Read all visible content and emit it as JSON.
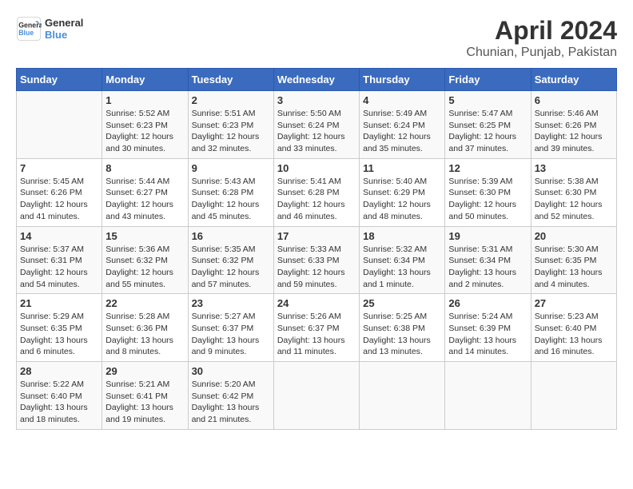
{
  "logo": {
    "line1": "General",
    "line2": "Blue"
  },
  "title": "April 2024",
  "subtitle": "Chunian, Punjab, Pakistan",
  "days_of_week": [
    "Sunday",
    "Monday",
    "Tuesday",
    "Wednesday",
    "Thursday",
    "Friday",
    "Saturday"
  ],
  "weeks": [
    [
      {
        "day": "",
        "info": ""
      },
      {
        "day": "1",
        "info": "Sunrise: 5:52 AM\nSunset: 6:23 PM\nDaylight: 12 hours\nand 30 minutes."
      },
      {
        "day": "2",
        "info": "Sunrise: 5:51 AM\nSunset: 6:23 PM\nDaylight: 12 hours\nand 32 minutes."
      },
      {
        "day": "3",
        "info": "Sunrise: 5:50 AM\nSunset: 6:24 PM\nDaylight: 12 hours\nand 33 minutes."
      },
      {
        "day": "4",
        "info": "Sunrise: 5:49 AM\nSunset: 6:24 PM\nDaylight: 12 hours\nand 35 minutes."
      },
      {
        "day": "5",
        "info": "Sunrise: 5:47 AM\nSunset: 6:25 PM\nDaylight: 12 hours\nand 37 minutes."
      },
      {
        "day": "6",
        "info": "Sunrise: 5:46 AM\nSunset: 6:26 PM\nDaylight: 12 hours\nand 39 minutes."
      }
    ],
    [
      {
        "day": "7",
        "info": "Sunrise: 5:45 AM\nSunset: 6:26 PM\nDaylight: 12 hours\nand 41 minutes."
      },
      {
        "day": "8",
        "info": "Sunrise: 5:44 AM\nSunset: 6:27 PM\nDaylight: 12 hours\nand 43 minutes."
      },
      {
        "day": "9",
        "info": "Sunrise: 5:43 AM\nSunset: 6:28 PM\nDaylight: 12 hours\nand 45 minutes."
      },
      {
        "day": "10",
        "info": "Sunrise: 5:41 AM\nSunset: 6:28 PM\nDaylight: 12 hours\nand 46 minutes."
      },
      {
        "day": "11",
        "info": "Sunrise: 5:40 AM\nSunset: 6:29 PM\nDaylight: 12 hours\nand 48 minutes."
      },
      {
        "day": "12",
        "info": "Sunrise: 5:39 AM\nSunset: 6:30 PM\nDaylight: 12 hours\nand 50 minutes."
      },
      {
        "day": "13",
        "info": "Sunrise: 5:38 AM\nSunset: 6:30 PM\nDaylight: 12 hours\nand 52 minutes."
      }
    ],
    [
      {
        "day": "14",
        "info": "Sunrise: 5:37 AM\nSunset: 6:31 PM\nDaylight: 12 hours\nand 54 minutes."
      },
      {
        "day": "15",
        "info": "Sunrise: 5:36 AM\nSunset: 6:32 PM\nDaylight: 12 hours\nand 55 minutes."
      },
      {
        "day": "16",
        "info": "Sunrise: 5:35 AM\nSunset: 6:32 PM\nDaylight: 12 hours\nand 57 minutes."
      },
      {
        "day": "17",
        "info": "Sunrise: 5:33 AM\nSunset: 6:33 PM\nDaylight: 12 hours\nand 59 minutes."
      },
      {
        "day": "18",
        "info": "Sunrise: 5:32 AM\nSunset: 6:34 PM\nDaylight: 13 hours\nand 1 minute."
      },
      {
        "day": "19",
        "info": "Sunrise: 5:31 AM\nSunset: 6:34 PM\nDaylight: 13 hours\nand 2 minutes."
      },
      {
        "day": "20",
        "info": "Sunrise: 5:30 AM\nSunset: 6:35 PM\nDaylight: 13 hours\nand 4 minutes."
      }
    ],
    [
      {
        "day": "21",
        "info": "Sunrise: 5:29 AM\nSunset: 6:35 PM\nDaylight: 13 hours\nand 6 minutes."
      },
      {
        "day": "22",
        "info": "Sunrise: 5:28 AM\nSunset: 6:36 PM\nDaylight: 13 hours\nand 8 minutes."
      },
      {
        "day": "23",
        "info": "Sunrise: 5:27 AM\nSunset: 6:37 PM\nDaylight: 13 hours\nand 9 minutes."
      },
      {
        "day": "24",
        "info": "Sunrise: 5:26 AM\nSunset: 6:37 PM\nDaylight: 13 hours\nand 11 minutes."
      },
      {
        "day": "25",
        "info": "Sunrise: 5:25 AM\nSunset: 6:38 PM\nDaylight: 13 hours\nand 13 minutes."
      },
      {
        "day": "26",
        "info": "Sunrise: 5:24 AM\nSunset: 6:39 PM\nDaylight: 13 hours\nand 14 minutes."
      },
      {
        "day": "27",
        "info": "Sunrise: 5:23 AM\nSunset: 6:40 PM\nDaylight: 13 hours\nand 16 minutes."
      }
    ],
    [
      {
        "day": "28",
        "info": "Sunrise: 5:22 AM\nSunset: 6:40 PM\nDaylight: 13 hours\nand 18 minutes."
      },
      {
        "day": "29",
        "info": "Sunrise: 5:21 AM\nSunset: 6:41 PM\nDaylight: 13 hours\nand 19 minutes."
      },
      {
        "day": "30",
        "info": "Sunrise: 5:20 AM\nSunset: 6:42 PM\nDaylight: 13 hours\nand 21 minutes."
      },
      {
        "day": "",
        "info": ""
      },
      {
        "day": "",
        "info": ""
      },
      {
        "day": "",
        "info": ""
      },
      {
        "day": "",
        "info": ""
      }
    ]
  ]
}
